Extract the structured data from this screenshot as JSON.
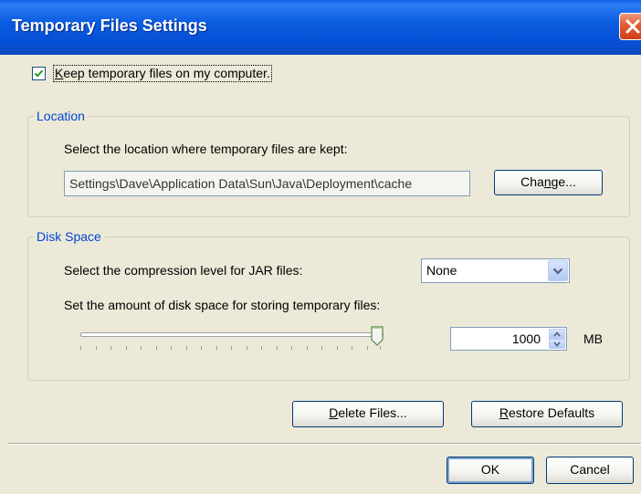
{
  "window": {
    "title": "Temporary Files Settings"
  },
  "keep_files": {
    "checked": true,
    "label_first": "K",
    "label_rest": "eep temporary files on my computer."
  },
  "location": {
    "group_title": "Location",
    "description": "Select the location where temporary files are kept:",
    "path_value": "Settings\\Dave\\Application Data\\Sun\\Java\\Deployment\\cache",
    "change_label_pre": "Cha",
    "change_label_ul": "n",
    "change_label_post": "ge..."
  },
  "disk_space": {
    "group_title": "Disk Space",
    "compression_label": "Select the compression level for JAR files:",
    "compression_value": "None",
    "amount_label": "Set the amount of disk space for storing temporary files:",
    "slider_level": 1.0,
    "amount_value": "1000",
    "unit": "MB"
  },
  "actions": {
    "delete_ul": "D",
    "delete_rest": "elete Files...",
    "restore_ul": "R",
    "restore_rest": "estore Defaults"
  },
  "footer": {
    "ok_label": "OK",
    "cancel_label": "Cancel"
  },
  "colors": {
    "title_bar": "#0b5de0",
    "group_title": "#0046d5",
    "close_button": "#e25b34",
    "dialog_background": "#ece9d8"
  },
  "icons": {
    "close": "close-icon",
    "checkmark": "checkmark-icon",
    "dropdown": "chevron-down-icon",
    "spin_up": "chevron-up-icon",
    "spin_down": "chevron-down-icon"
  }
}
